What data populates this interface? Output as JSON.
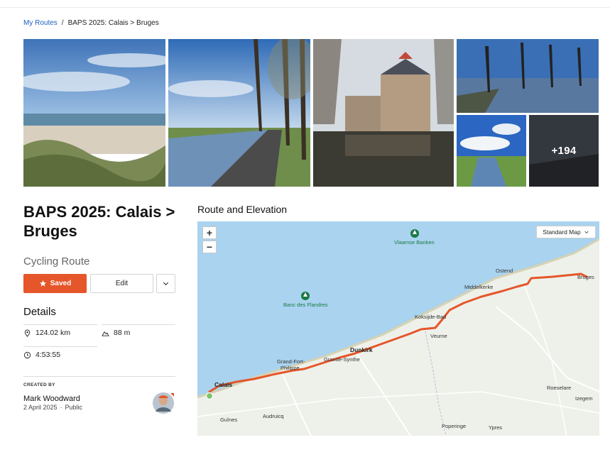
{
  "breadcrumb": {
    "parent": "My Routes",
    "separator": "/",
    "current": "BAPS 2025: Calais > Bruges"
  },
  "gallery": {
    "more_count": "+194"
  },
  "route": {
    "title": "BAPS 2025: Calais > Bruges",
    "type": "Cycling Route"
  },
  "actions": {
    "saved_label": "Saved",
    "edit_label": "Edit"
  },
  "details": {
    "heading": "Details",
    "distance": "124.02 km",
    "elevation": "88 m",
    "duration": "4:53:55"
  },
  "creator": {
    "label": "CREATED BY",
    "name": "Mark Woodward",
    "date": "2 April 2025",
    "dot": "·",
    "visibility": "Public"
  },
  "map": {
    "heading": "Route and Elevation",
    "zoom_in": "+",
    "zoom_out": "−",
    "style_select": "Standard Map",
    "places": {
      "vlaamse": "Vlaamse Banken",
      "banc": "Banc des Flandres",
      "ostend": "Ostend",
      "bruges": "Bruges",
      "middelkerke": "Middelkerke",
      "koksijde": "Koksijde-Bad",
      "veurne": "Veurne",
      "dunkirk": "Dunkirk",
      "grande_synthe": "Grande-Synthe",
      "grand_fort_1": "Grand-Fort-",
      "grand_fort_2": "Philippe",
      "calais": "Calais",
      "roeselare": "Roeselare",
      "izegem": "Izegem",
      "audruicq": "Audruicq",
      "guines": "Guînes",
      "poperinge": "Poperinge",
      "ypres": "Ypres"
    }
  },
  "colors": {
    "accent": "#e5562a",
    "link": "#1f5fbf",
    "sea": "#a9d3ef",
    "land": "#eef1ea",
    "route": "#e5562a"
  },
  "icons": [
    "star-icon",
    "chevron-down-icon",
    "location-pin-icon",
    "mountain-icon",
    "clock-icon",
    "tree-poi-icon"
  ]
}
